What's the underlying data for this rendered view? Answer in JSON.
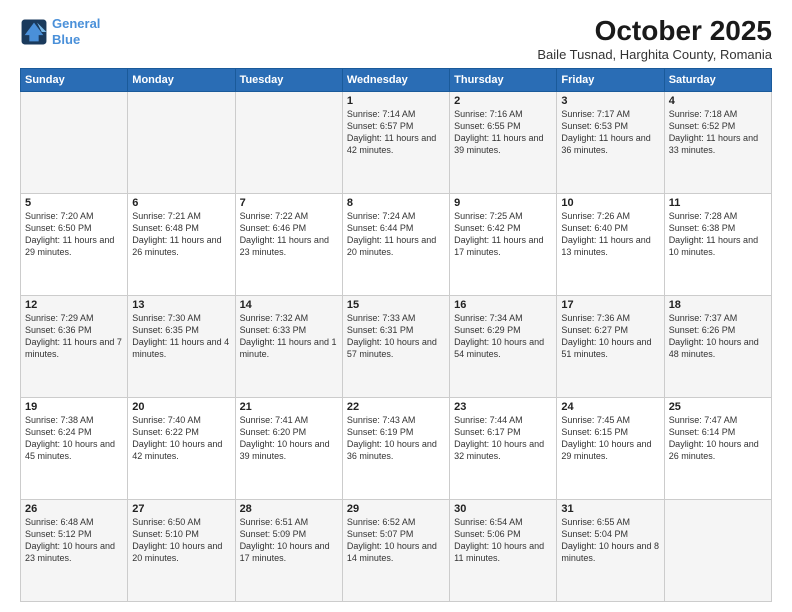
{
  "logo": {
    "line1": "General",
    "line2": "Blue"
  },
  "title": "October 2025",
  "subtitle": "Baile Tusnad, Harghita County, Romania",
  "weekdays": [
    "Sunday",
    "Monday",
    "Tuesday",
    "Wednesday",
    "Thursday",
    "Friday",
    "Saturday"
  ],
  "weeks": [
    [
      {
        "day": "",
        "info": ""
      },
      {
        "day": "",
        "info": ""
      },
      {
        "day": "",
        "info": ""
      },
      {
        "day": "1",
        "info": "Sunrise: 7:14 AM\nSunset: 6:57 PM\nDaylight: 11 hours and 42 minutes."
      },
      {
        "day": "2",
        "info": "Sunrise: 7:16 AM\nSunset: 6:55 PM\nDaylight: 11 hours and 39 minutes."
      },
      {
        "day": "3",
        "info": "Sunrise: 7:17 AM\nSunset: 6:53 PM\nDaylight: 11 hours and 36 minutes."
      },
      {
        "day": "4",
        "info": "Sunrise: 7:18 AM\nSunset: 6:52 PM\nDaylight: 11 hours and 33 minutes."
      }
    ],
    [
      {
        "day": "5",
        "info": "Sunrise: 7:20 AM\nSunset: 6:50 PM\nDaylight: 11 hours and 29 minutes."
      },
      {
        "day": "6",
        "info": "Sunrise: 7:21 AM\nSunset: 6:48 PM\nDaylight: 11 hours and 26 minutes."
      },
      {
        "day": "7",
        "info": "Sunrise: 7:22 AM\nSunset: 6:46 PM\nDaylight: 11 hours and 23 minutes."
      },
      {
        "day": "8",
        "info": "Sunrise: 7:24 AM\nSunset: 6:44 PM\nDaylight: 11 hours and 20 minutes."
      },
      {
        "day": "9",
        "info": "Sunrise: 7:25 AM\nSunset: 6:42 PM\nDaylight: 11 hours and 17 minutes."
      },
      {
        "day": "10",
        "info": "Sunrise: 7:26 AM\nSunset: 6:40 PM\nDaylight: 11 hours and 13 minutes."
      },
      {
        "day": "11",
        "info": "Sunrise: 7:28 AM\nSunset: 6:38 PM\nDaylight: 11 hours and 10 minutes."
      }
    ],
    [
      {
        "day": "12",
        "info": "Sunrise: 7:29 AM\nSunset: 6:36 PM\nDaylight: 11 hours and 7 minutes."
      },
      {
        "day": "13",
        "info": "Sunrise: 7:30 AM\nSunset: 6:35 PM\nDaylight: 11 hours and 4 minutes."
      },
      {
        "day": "14",
        "info": "Sunrise: 7:32 AM\nSunset: 6:33 PM\nDaylight: 11 hours and 1 minute."
      },
      {
        "day": "15",
        "info": "Sunrise: 7:33 AM\nSunset: 6:31 PM\nDaylight: 10 hours and 57 minutes."
      },
      {
        "day": "16",
        "info": "Sunrise: 7:34 AM\nSunset: 6:29 PM\nDaylight: 10 hours and 54 minutes."
      },
      {
        "day": "17",
        "info": "Sunrise: 7:36 AM\nSunset: 6:27 PM\nDaylight: 10 hours and 51 minutes."
      },
      {
        "day": "18",
        "info": "Sunrise: 7:37 AM\nSunset: 6:26 PM\nDaylight: 10 hours and 48 minutes."
      }
    ],
    [
      {
        "day": "19",
        "info": "Sunrise: 7:38 AM\nSunset: 6:24 PM\nDaylight: 10 hours and 45 minutes."
      },
      {
        "day": "20",
        "info": "Sunrise: 7:40 AM\nSunset: 6:22 PM\nDaylight: 10 hours and 42 minutes."
      },
      {
        "day": "21",
        "info": "Sunrise: 7:41 AM\nSunset: 6:20 PM\nDaylight: 10 hours and 39 minutes."
      },
      {
        "day": "22",
        "info": "Sunrise: 7:43 AM\nSunset: 6:19 PM\nDaylight: 10 hours and 36 minutes."
      },
      {
        "day": "23",
        "info": "Sunrise: 7:44 AM\nSunset: 6:17 PM\nDaylight: 10 hours and 32 minutes."
      },
      {
        "day": "24",
        "info": "Sunrise: 7:45 AM\nSunset: 6:15 PM\nDaylight: 10 hours and 29 minutes."
      },
      {
        "day": "25",
        "info": "Sunrise: 7:47 AM\nSunset: 6:14 PM\nDaylight: 10 hours and 26 minutes."
      }
    ],
    [
      {
        "day": "26",
        "info": "Sunrise: 6:48 AM\nSunset: 5:12 PM\nDaylight: 10 hours and 23 minutes."
      },
      {
        "day": "27",
        "info": "Sunrise: 6:50 AM\nSunset: 5:10 PM\nDaylight: 10 hours and 20 minutes."
      },
      {
        "day": "28",
        "info": "Sunrise: 6:51 AM\nSunset: 5:09 PM\nDaylight: 10 hours and 17 minutes."
      },
      {
        "day": "29",
        "info": "Sunrise: 6:52 AM\nSunset: 5:07 PM\nDaylight: 10 hours and 14 minutes."
      },
      {
        "day": "30",
        "info": "Sunrise: 6:54 AM\nSunset: 5:06 PM\nDaylight: 10 hours and 11 minutes."
      },
      {
        "day": "31",
        "info": "Sunrise: 6:55 AM\nSunset: 5:04 PM\nDaylight: 10 hours and 8 minutes."
      },
      {
        "day": "",
        "info": ""
      }
    ]
  ]
}
